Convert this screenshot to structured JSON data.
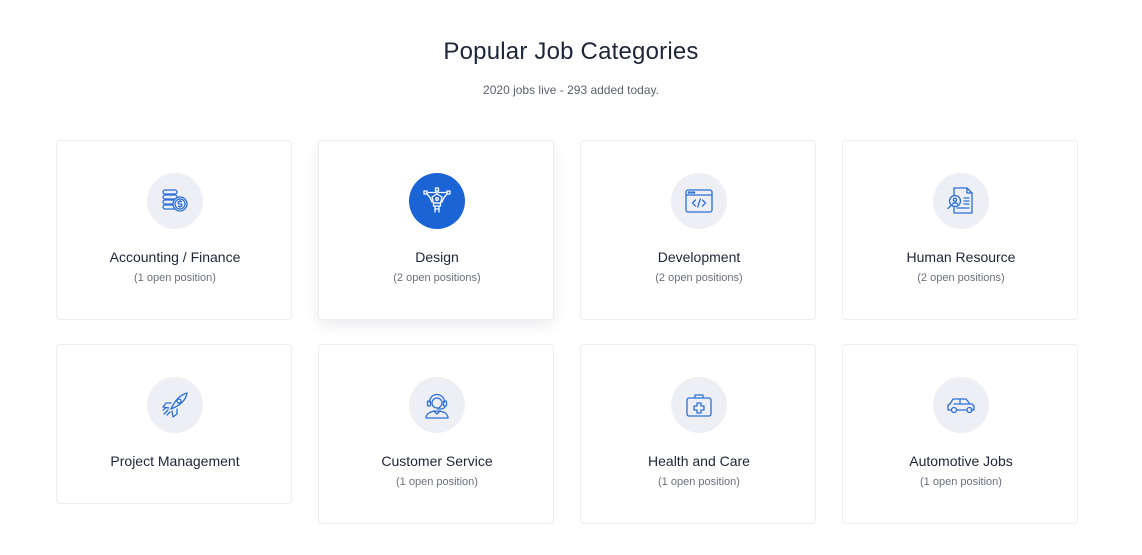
{
  "header": {
    "title": "Popular Job Categories",
    "subtitle": "2020 jobs live - 293 added today."
  },
  "colors": {
    "accent": "#1a64d6",
    "icon_stroke": "#2b6fd6",
    "icon_bg": "#eeeff4"
  },
  "categories": [
    {
      "name": "Accounting / Finance",
      "count": "(1 open position)",
      "icon": "coins-icon"
    },
    {
      "name": "Design",
      "count": "(2 open positions)",
      "icon": "pen-tool-icon",
      "active": true
    },
    {
      "name": "Development",
      "count": "(2 open positions)",
      "icon": "code-window-icon"
    },
    {
      "name": "Human Resource",
      "count": "(2 open positions)",
      "icon": "resume-search-icon"
    },
    {
      "name": "Project Management",
      "count": "",
      "icon": "rocket-icon"
    },
    {
      "name": "Customer Service",
      "count": "(1 open position)",
      "icon": "headset-agent-icon"
    },
    {
      "name": "Health and Care",
      "count": "(1 open position)",
      "icon": "medical-kit-icon"
    },
    {
      "name": "Automotive Jobs",
      "count": "(1 open position)",
      "icon": "car-icon"
    }
  ]
}
